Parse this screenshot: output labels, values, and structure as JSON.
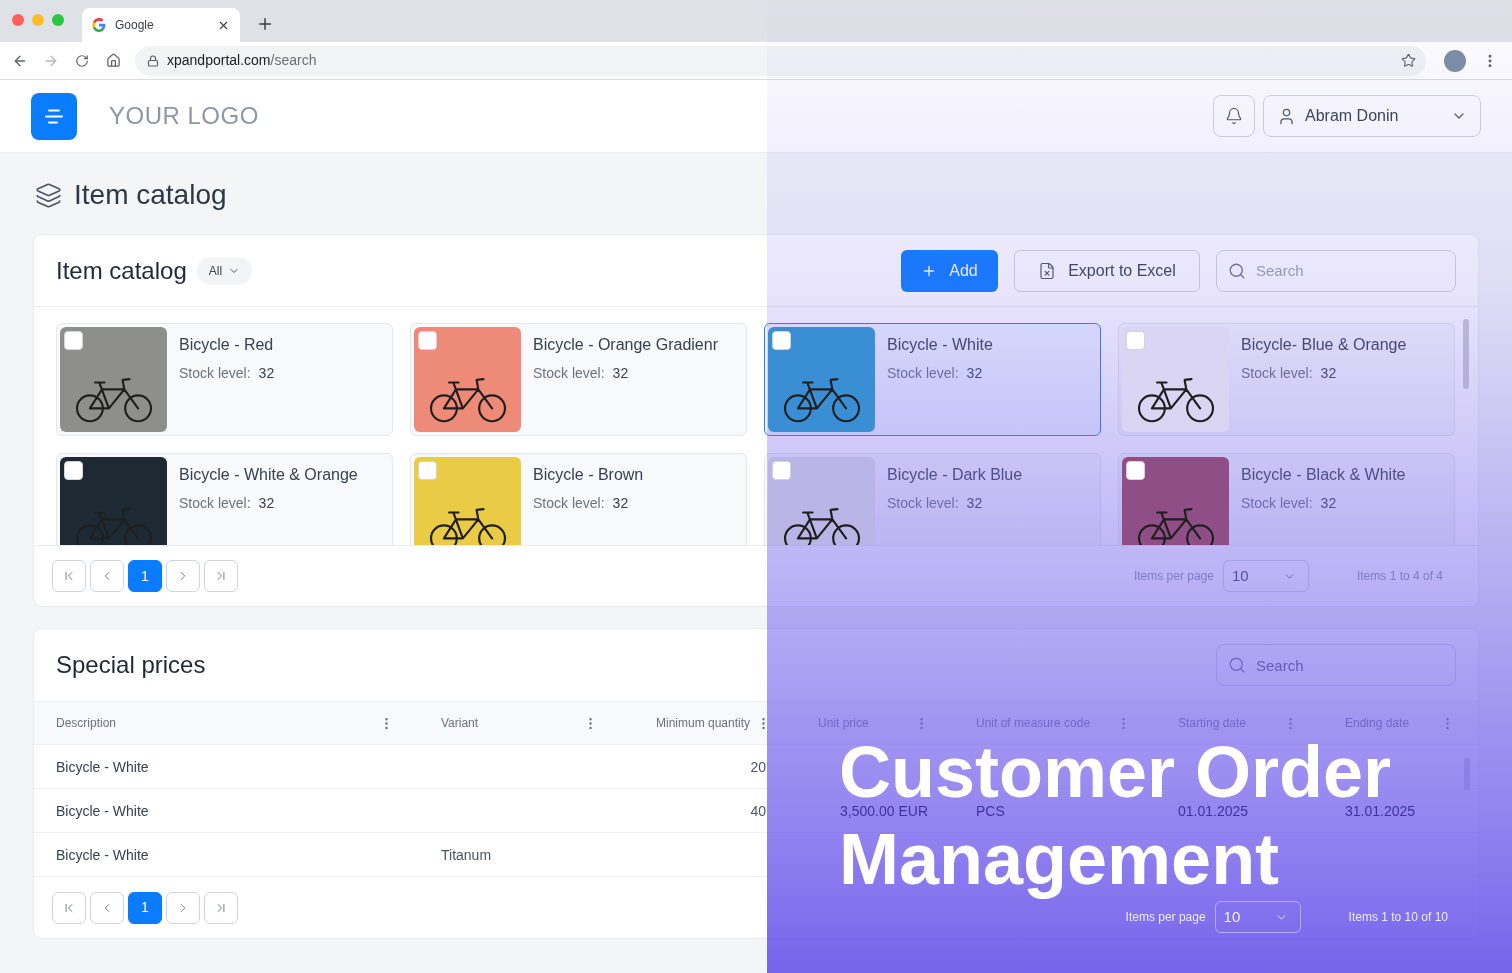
{
  "browser": {
    "tab_title": "Google",
    "url_host": "xpandportal.com",
    "url_path": "/search"
  },
  "header": {
    "logo": "YOUR LOGO",
    "user": "Abram Donin"
  },
  "page_title": "Item catalog",
  "catalog": {
    "title": "Item catalog",
    "filter": "All",
    "add_button": "Add",
    "export_button": "Export to Excel",
    "search": {
      "placeholder": "Search"
    },
    "items": [
      {
        "name": "Bicycle - Red",
        "stock_label": "Stock level:",
        "stock": "32",
        "color": "#8e8e8c",
        "checked": false,
        "selected": false
      },
      {
        "name": "Bicycle - Orange Gradienr",
        "stock_label": "Stock level:",
        "stock": "32",
        "color": "#ee8a78",
        "checked": false,
        "selected": false
      },
      {
        "name": "Bicycle - White",
        "stock_label": "Stock level:",
        "stock": "32",
        "color": "#3a8fd4",
        "checked": false,
        "selected": true
      },
      {
        "name": "Bicycle- Blue & Orange",
        "stock_label": "Stock level:",
        "stock": "32",
        "color": "#d9d5f2",
        "checked": false,
        "selected": false
      },
      {
        "name": "Bicycle - White & Orange",
        "stock_label": "Stock level:",
        "stock": "32",
        "color": "#1e2a33",
        "checked": false,
        "selected": false
      },
      {
        "name": "Bicycle - Brown",
        "stock_label": "Stock level:",
        "stock": "32",
        "color": "#e9cb45",
        "checked": false,
        "selected": false
      },
      {
        "name": "Bicycle - Dark Blue",
        "stock_label": "Stock level:",
        "stock": "32",
        "color": "#b9b5e6",
        "checked": false,
        "selected": false
      },
      {
        "name": "Bicycle - Black & White",
        "stock_label": "Stock level:",
        "stock": "32",
        "color": "#8f4f86",
        "checked": false,
        "selected": false
      }
    ],
    "pagination": {
      "pages": [
        {
          "label": "1",
          "selected": true
        }
      ],
      "per_page_label": "Items per page",
      "per_page": "10",
      "summary": "Items 1 to 4 of 4"
    }
  },
  "special_prices": {
    "title": "Special prices",
    "search": {
      "placeholder": "Search"
    },
    "columns": [
      {
        "label": "Description",
        "kind": "text"
      },
      {
        "label": "Variant",
        "kind": "text"
      },
      {
        "label": "Minimum quantity",
        "kind": "number"
      },
      {
        "label": "Unit price",
        "kind": "number"
      },
      {
        "label": "Unit of measure code",
        "kind": "text"
      },
      {
        "label": "Starting date",
        "kind": "text"
      },
      {
        "label": "Ending date",
        "kind": "text"
      }
    ],
    "rows": [
      [
        "Bicycle - White",
        null,
        "20",
        null,
        null,
        null,
        null
      ],
      [
        "Bicycle - White",
        null,
        "40",
        "3,500.00 EUR",
        "PCS",
        "01.01.2025",
        "31.01.2025"
      ],
      [
        "Bicycle - White",
        "Titanum",
        null,
        null,
        null,
        null,
        null
      ]
    ],
    "pagination": {
      "pages": [
        {
          "label": "1",
          "selected": true
        }
      ],
      "per_page_label": "Items per page",
      "per_page": "10",
      "summary": "Items 1 to 10 of 10"
    }
  },
  "overlay": {
    "title_lines": [
      "Customer Order",
      "Management"
    ]
  }
}
